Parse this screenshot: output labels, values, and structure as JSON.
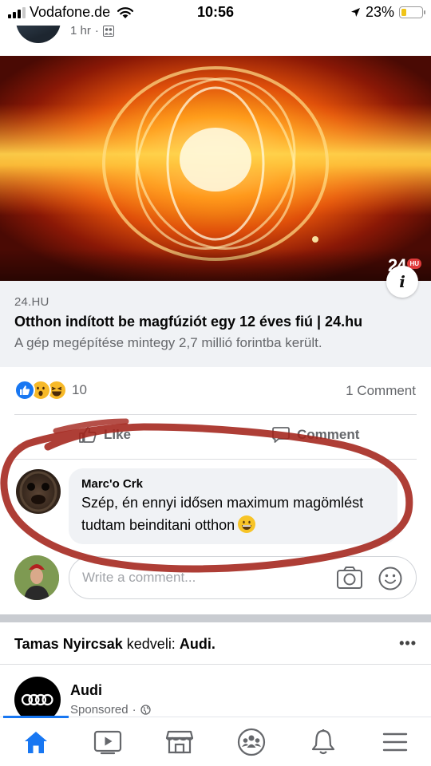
{
  "status_bar": {
    "carrier": "Vodafone.de",
    "time": "10:56",
    "battery_percent": "23%",
    "battery_level": 0.23,
    "signal_bars_filled": 3,
    "signal_bars_total": 4
  },
  "post": {
    "time_ago": "1 hr",
    "separator": "·",
    "audience_icon": "friends-icon"
  },
  "link_preview": {
    "image_overlay_logo": "24",
    "image_overlay_badge": "HU",
    "info_icon": "info-icon",
    "domain": "24.HU",
    "title": "Otthon indított be magfúziót egy 12 éves fiú | 24.hu",
    "description": "A gép megépítése mintegy 2,7 millió forintba került."
  },
  "reactions": {
    "types": [
      "like",
      "wow",
      "haha"
    ],
    "count": "10",
    "comments_count": "1 Comment"
  },
  "actions": {
    "like_label": "Like",
    "comment_label": "Comment"
  },
  "comment": {
    "author": "Marc'o Crk",
    "text": "Szép, én ennyi idősen maximum magömlést tudtam beinditani otthon",
    "emoji": "grinning-face"
  },
  "composer": {
    "placeholder": "Write a comment...",
    "camera_icon": "camera-icon",
    "emoji_icon": "smiley-icon"
  },
  "next_story": {
    "actor": "Tamas Nyircsak",
    "verb": "kedveli:",
    "page": "Audi.",
    "more_label": "•••",
    "page_name": "Audi",
    "sponsored_label": "Sponsored",
    "separator": "·"
  },
  "tabbar": {
    "items": [
      "home",
      "watch",
      "marketplace",
      "groups",
      "notifications",
      "menu"
    ],
    "active": "home",
    "accent_color": "#1877f2"
  },
  "colors": {
    "annotation": "#a3231a",
    "secondary_text": "#65676b",
    "bubble_bg": "#f0f2f5"
  }
}
